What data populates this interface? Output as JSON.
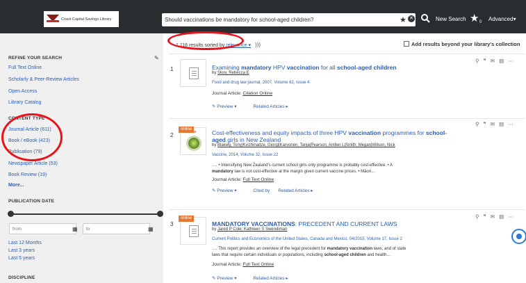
{
  "header": {
    "logo_text": "Coast Capital Savings Library",
    "search_value": "Should vaccinations be mandatory for school-aged children?",
    "new_search_label": "New Search",
    "saved_count": "0",
    "advanced_label": "Advanced▾",
    "star_icon": "star-icon",
    "clear_icon": "clear-icon",
    "search_icon": "search-icon"
  },
  "sidebar": {
    "refine_heading": "REFINE YOUR SEARCH",
    "refine_items": [
      "Full Text Online",
      "Scholarly & Peer-Review Articles",
      "Open Access",
      "Library Catalog"
    ],
    "content_type_heading": "CONTENT TYPE",
    "content_types": [
      "Journal Article (611)",
      "Book / eBook (423)",
      "Publication (79)",
      "Newspaper Article (53)",
      "Book Review (19)"
    ],
    "more_label": "More...",
    "pub_date_heading": "PUBLICATION DATE",
    "from_placeholder": "from",
    "to_placeholder": "to",
    "date_ranges": [
      "Last 12 Months",
      "Last 3 years",
      "Last 5 years"
    ],
    "discipline_heading": "DISCIPLINE"
  },
  "main": {
    "results_count": "1,116 results sorted by",
    "sort_value": "relevance ▾",
    "beyond_label": "Add results beyond your library's collection",
    "online_label": "online",
    "results": [
      {
        "num": "1",
        "title_parts": [
          "Examining ",
          "mandatory",
          " HPV ",
          "vaccination",
          " for all ",
          "school-aged children"
        ],
        "author": "Skov, Rebecca E",
        "source": "Food and drug law journal, 2007, Volume 62, Issue 4",
        "type_label": "Journal Article:",
        "type_link": "Citation Online",
        "actions": [
          "Preview ▾",
          "Related Articles ▸"
        ]
      },
      {
        "num": "2",
        "title_line1": "Cost-effectiveness and equity impacts of three HPV ",
        "title_bold1": "vaccination",
        "title_mid": " programmes for ",
        "title_bold2": "school-",
        "title_line2_bold": "aged",
        "title_line2_tail": " girls in New Zealand",
        "author": "Blakely, Tony|Kvizhinadze, Giorgi|Karvonen, Tanja|Pearson, Amber L|Smith, Megan|Wilson, Nick",
        "source": "Vaccine, 2014, Volume 32, Issue 22",
        "snippet_1": "…. • Intensifying New Zealand's current school girls only programme is probably cost-effective. • A",
        "snippet_2_bold": "mandatory",
        "snippet_2_tail": " law is not cost-effective at the margin given current vaccine prices. • Māori…",
        "type_label": "Journal Article:",
        "type_link": "Full Text Online",
        "actions": [
          "Preview ▾",
          "Cited by",
          "Related Articles ▸"
        ],
        "image_label": "Vaccine"
      },
      {
        "num": "3",
        "title_bold1": "MANDATORY VACCINATIONS",
        "title_tail": ": PRECEDENT AND CURRENT LAWS",
        "author": "Jared P Cole; Kathleen S Swendiman",
        "source": "Current Politics and Economics of the United States, Canada and Mexico, 04/2015, Volume 17, Issue 2",
        "snippet_1a": "…. This report provides an overview of the legal precedent for ",
        "snippet_1b": "mandatory vaccination",
        "snippet_1c": " laws, and of state",
        "snippet_2a": "laws that require certain individuals or populations, including ",
        "snippet_2b": "school-aged children",
        "snippet_2c": " and health…",
        "type_label": "Journal Article:",
        "type_link": "Full Text Online",
        "actions": [
          "Preview ▾",
          "Related Articles ▸"
        ]
      }
    ]
  },
  "colors": {
    "header_bg": "#2a2d30",
    "link": "#2a5db0",
    "online_tag": "#e8772e",
    "annotation": "#e8121b"
  }
}
